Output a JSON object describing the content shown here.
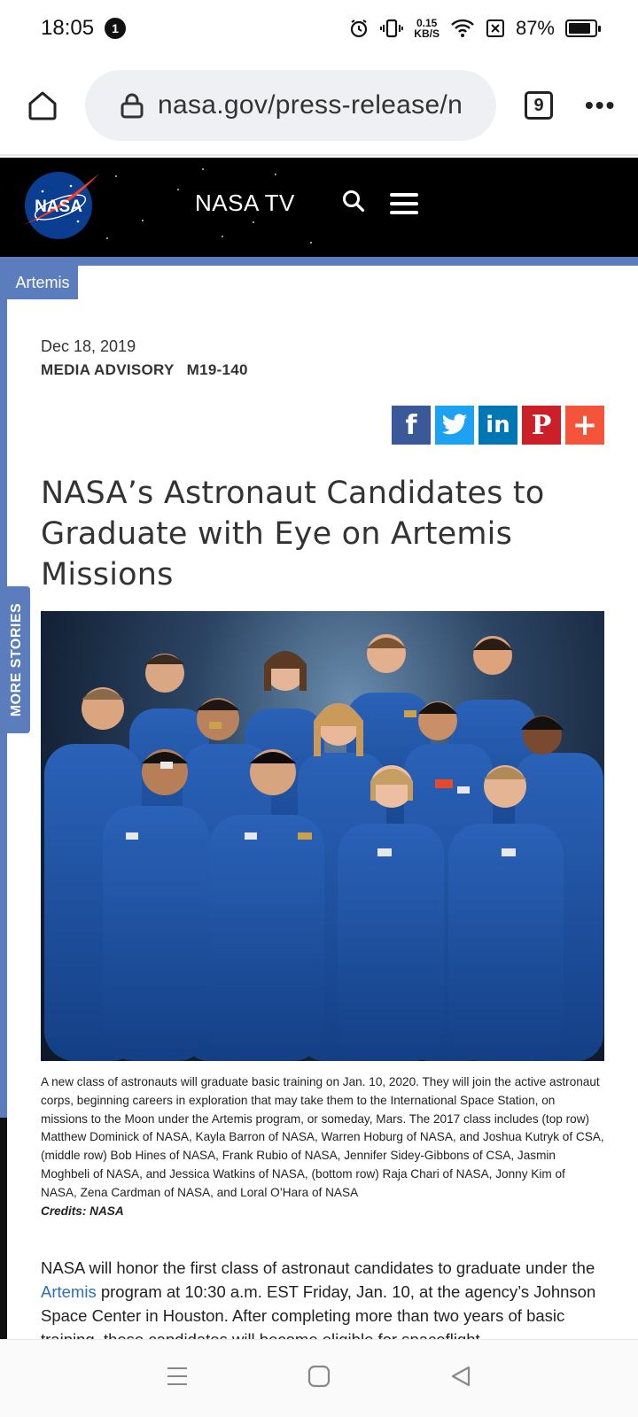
{
  "status_bar": {
    "time": "18:05",
    "notification_count": "1",
    "speed_value": "0.15",
    "speed_unit": "KB/S",
    "battery": "87%",
    "battery_level": 0.87
  },
  "browser": {
    "url": "nasa.gov/press-release/n",
    "tab_count": "9",
    "menu": "•••"
  },
  "site_header": {
    "logo_text": "NASA",
    "nav_link": "NASA TV"
  },
  "category_tag": "Artemis",
  "side_tab": "MORE STORIES",
  "article": {
    "date": "Dec 18, 2019",
    "type": "MEDIA ADVISORY",
    "number": "M19-140",
    "headline": "NASA’s Astronaut Candidates to Graduate with Eye on Artemis Missions",
    "caption": "A new class of astronauts will graduate basic training on Jan. 10, 2020. They will join the active astronaut corps, beginning careers in exploration that may take them to the International Space Station, on missions to the Moon under the Artemis program, or someday, Mars. The 2017 class includes (top row) Matthew Dominick of NASA, Kayla Barron of NASA, Warren Hoburg of NASA, and Joshua Kutryk of CSA, (middle row) Bob Hines of NASA, Frank Rubio of NASA, Jennifer Sidey-Gibbons of CSA, Jasmin Moghbeli of NASA, and Jessica Watkins of NASA, (bottom row) Raja Chari of NASA, Jonny Kim of NASA, Zena Cardman of NASA, and Loral O’Hara of NASA",
    "credits": "Credits: NASA",
    "body_before": "NASA will honor the first class of astronaut candidates to graduate under the ",
    "body_link": "Artemis",
    "body_after": " program at 10:30 a.m. EST Friday, Jan. 10, at the agency’s Johnson Space Center in Houston. After completing more than two years of basic training, these candidates will become eligible for spaceflight"
  },
  "share_buttons": [
    {
      "name": "facebook",
      "glyph": "f",
      "color": "#3b5998"
    },
    {
      "name": "twitter",
      "glyph": "twitter-bird",
      "color": "#1da1f2"
    },
    {
      "name": "linkedin",
      "glyph": "in",
      "color": "#0077b5"
    },
    {
      "name": "pinterest",
      "glyph": "P",
      "color": "#cb2027"
    },
    {
      "name": "more",
      "glyph": "+",
      "color": "#f3543a"
    }
  ],
  "colors": {
    "accent_blue": "#5b7dbd",
    "link_blue": "#2e6fb7",
    "header_black": "#000000",
    "suit_blue": "#1d4f9e"
  },
  "icons": {
    "status": [
      "alarm-icon",
      "vibrate-icon",
      "wifi-icon",
      "sim-off-icon",
      "battery-icon"
    ],
    "browser": [
      "home-icon",
      "lock-icon",
      "tabs-icon",
      "more-icon"
    ],
    "header": [
      "nasa-logo",
      "search-icon",
      "hamburger-icon"
    ],
    "nav": [
      "recents-icon",
      "home-square-icon",
      "back-icon"
    ]
  }
}
